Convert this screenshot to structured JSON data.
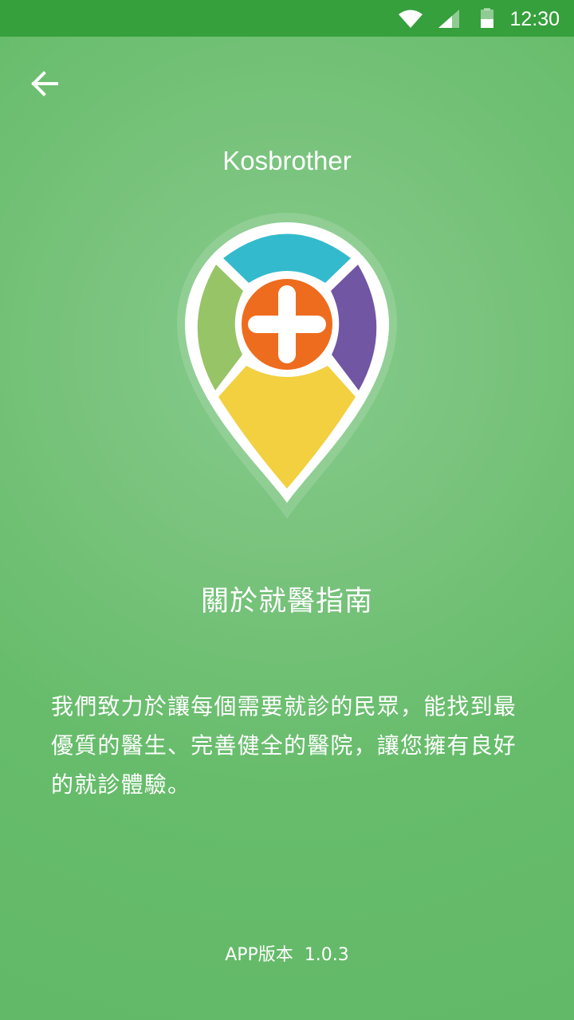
{
  "status_bar": {
    "time": "12:30",
    "icons": [
      "wifi-icon",
      "signal-icon",
      "battery-icon"
    ]
  },
  "header": {
    "back_icon": "arrow-left-icon",
    "app_name": "Kosbrother"
  },
  "logo": {
    "icon": "location-pin-medical-cross-icon",
    "colors": {
      "top": "#34bacd",
      "left": "#97c467",
      "right": "#7156a3",
      "bottom": "#f2d03f",
      "center": "#ee6c1e",
      "outline": "#ffffff"
    }
  },
  "about": {
    "title": "關於就醫指南",
    "description": "我們致力於讓每個需要就診的民眾，能找到最優質的醫生、完善健全的醫院，讓您擁有良好的就診體驗。"
  },
  "footer": {
    "version_label": "APP版本",
    "version_number": "1.0.3"
  },
  "colors": {
    "status_bar": "#36a03c",
    "background": "#66bc6a",
    "text": "#ffffff"
  }
}
